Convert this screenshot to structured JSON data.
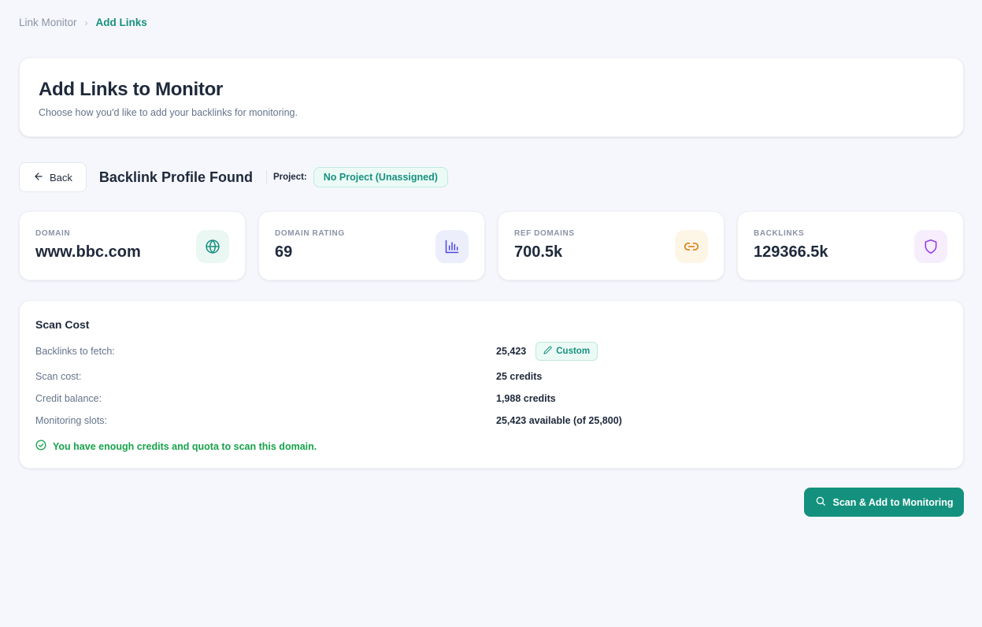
{
  "breadcrumb": {
    "root": "Link Monitor",
    "separator": "›",
    "current": "Add Links"
  },
  "header": {
    "title": "Add Links to Monitor",
    "subtitle": "Choose how you'd like to add your backlinks for monitoring."
  },
  "toolbar": {
    "back_label": "Back",
    "title": "Backlink Profile Found",
    "project_label": "Project:",
    "project_value": "No Project (Unassigned)"
  },
  "stats": [
    {
      "label": "DOMAIN",
      "value": "www.bbc.com",
      "icon": "globe-icon",
      "icon_color": "#17917f",
      "icon_bg": "#eaf7f3"
    },
    {
      "label": "DOMAIN RATING",
      "value": "69",
      "icon": "bar-chart-icon",
      "icon_color": "#4f46e5",
      "icon_bg": "#eceefc"
    },
    {
      "label": "REF DOMAINS",
      "value": "700.5k",
      "icon": "link-icon",
      "icon_color": "#d97706",
      "icon_bg": "#fdf5e6"
    },
    {
      "label": "BACKLINKS",
      "value": "129366.5k",
      "icon": "shield-icon",
      "icon_color": "#9333ea",
      "icon_bg": "#f6eefd"
    }
  ],
  "scan_cost": {
    "title": "Scan Cost",
    "rows": [
      {
        "label": "Backlinks to fetch:",
        "value": "25,423"
      },
      {
        "label": "Scan cost:",
        "value": "25 credits"
      },
      {
        "label": "Credit balance:",
        "value": "1,988 credits"
      },
      {
        "label": "Monitoring slots:",
        "value": "25,423 available (of 25,800)"
      }
    ],
    "custom_label": "Custom",
    "status_message": "You have enough credits and quota to scan this domain."
  },
  "actions": {
    "scan_label": "Scan & Add to Monitoring"
  },
  "colors": {
    "accent": "#13917e",
    "success": "#16a34a",
    "background": "#f6f7fc"
  }
}
